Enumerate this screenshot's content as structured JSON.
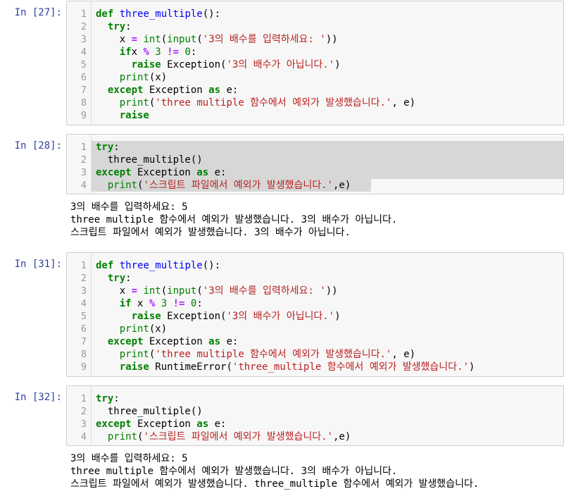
{
  "cells": [
    {
      "prompt": "In [27]:",
      "lines": [
        {
          "n": "1",
          "tokens": [
            [
              "kw",
              "def"
            ],
            [
              "",
              "  "
            ],
            [
              "fn",
              "three_multiple"
            ],
            [
              "",
              "():"
            ]
          ]
        },
        {
          "n": "2",
          "tokens": [
            [
              "",
              "    "
            ],
            [
              "kw",
              "try"
            ],
            [
              "",
              ":"
            ]
          ]
        },
        {
          "n": "3",
          "tokens": [
            [
              "",
              "        x "
            ],
            [
              "op",
              "="
            ],
            [
              "",
              ""
            ],
            [
              "bi",
              " int"
            ],
            [
              "",
              "("
            ],
            [
              "bi",
              "input"
            ],
            [
              "",
              "("
            ],
            [
              "str",
              "'3의 배수를 입력하세요: '"
            ],
            [
              "",
              "))"
            ]
          ]
        },
        {
          "n": "4",
          "tokens": [
            [
              "",
              "        "
            ],
            [
              "kw",
              "if"
            ],
            [
              "",
              ""
            ],
            [
              "",
              ""
            ],
            [
              "",
              ""
            ],
            [
              "",
              ""
            ],
            [
              "",
              ""
            ],
            [
              "",
              ""
            ],
            [
              "",
              ""
            ],
            [
              "",
              "x "
            ],
            [
              "op",
              "%"
            ],
            [
              "",
              ""
            ],
            [
              "num",
              " 3 "
            ],
            [
              "op",
              "!="
            ],
            [
              "num",
              " 0"
            ],
            [
              "",
              ":"
            ]
          ]
        },
        {
          "n": "5",
          "tokens": [
            [
              "",
              "            "
            ],
            [
              "kw",
              "raise"
            ],
            [
              "",
              "  Exception("
            ],
            [
              "str",
              "'3의 배수가 아닙니다.'"
            ],
            [
              "",
              ")"
            ]
          ]
        },
        {
          "n": "6",
          "tokens": [
            [
              "",
              "        "
            ],
            [
              "bi",
              "print"
            ],
            [
              "",
              "(x)"
            ]
          ]
        },
        {
          "n": "7",
          "tokens": [
            [
              "",
              "    "
            ],
            [
              "kw",
              "except"
            ],
            [
              "",
              "  Exception "
            ],
            [
              "kw",
              "as"
            ],
            [
              "",
              "  e:"
            ]
          ]
        },
        {
          "n": "8",
          "tokens": [
            [
              "",
              "        "
            ],
            [
              "bi",
              "print"
            ],
            [
              "",
              "("
            ],
            [
              "str",
              "'three multiple 함수에서 예외가 발생했습니다.'"
            ],
            [
              "",
              ", e)"
            ]
          ]
        },
        {
          "n": "9",
          "tokens": [
            [
              "",
              "        "
            ],
            [
              "kw",
              "raise"
            ]
          ]
        }
      ],
      "output": []
    },
    {
      "prompt": "In [28]:",
      "lines": [
        {
          "n": "1",
          "tokens": [
            [
              "kw",
              "try"
            ],
            [
              "",
              ":"
            ]
          ]
        },
        {
          "n": "2",
          "tokens": [
            [
              "",
              "    three_multiple()"
            ]
          ]
        },
        {
          "n": "3",
          "tokens": [
            [
              "kw",
              "except"
            ],
            [
              "",
              "  Exception "
            ],
            [
              "kw",
              "as"
            ],
            [
              "",
              "  e:"
            ]
          ]
        },
        {
          "n": "4",
          "tokens": [
            [
              "",
              "    "
            ],
            [
              "bi",
              "print"
            ],
            [
              "",
              "("
            ],
            [
              "str",
              "'스크립트 파일에서 예외가 발생했습니다.'"
            ],
            [
              "",
              ",e)"
            ]
          ]
        }
      ],
      "output": [
        "3의 배수를 입력하세요: 5",
        "three multiple 함수에서 예외가 발생했습니다. 3의 배수가 아닙니다.",
        "스크립트 파일에서 예외가 발생했습니다. 3의 배수가 아닙니다."
      ]
    },
    {
      "prompt": "In [31]:",
      "lines": [
        {
          "n": "1",
          "tokens": [
            [
              "kw",
              "def"
            ],
            [
              "",
              "  "
            ],
            [
              "fn",
              "three_multiple"
            ],
            [
              "",
              "():"
            ]
          ]
        },
        {
          "n": "2",
          "tokens": [
            [
              "",
              "    "
            ],
            [
              "kw",
              "try"
            ],
            [
              "",
              ":"
            ]
          ]
        },
        {
          "n": "3",
          "tokens": [
            [
              "",
              "        x "
            ],
            [
              "op",
              "="
            ],
            [
              "bi",
              " int"
            ],
            [
              "",
              "("
            ],
            [
              "bi",
              "input"
            ],
            [
              "",
              "("
            ],
            [
              "str",
              "'3의 배수를 입력하세요: '"
            ],
            [
              "",
              "))"
            ]
          ]
        },
        {
          "n": "4",
          "tokens": [
            [
              "",
              "        "
            ],
            [
              "kw",
              "if"
            ],
            [
              "",
              "  x "
            ],
            [
              "op",
              "%"
            ],
            [
              "num",
              " 3 "
            ],
            [
              "op",
              "!="
            ],
            [
              "num",
              " 0"
            ],
            [
              "",
              ":"
            ]
          ]
        },
        {
          "n": "5",
          "tokens": [
            [
              "",
              "            "
            ],
            [
              "kw",
              "raise"
            ],
            [
              "",
              "  Exception("
            ],
            [
              "str",
              "'3의 배수가 아닙니다.'"
            ],
            [
              "",
              ")"
            ]
          ]
        },
        {
          "n": "6",
          "tokens": [
            [
              "",
              "        "
            ],
            [
              "bi",
              "print"
            ],
            [
              "",
              "(x)"
            ]
          ]
        },
        {
          "n": "7",
          "tokens": [
            [
              "",
              "    "
            ],
            [
              "kw",
              "except"
            ],
            [
              "",
              "  Exception "
            ],
            [
              "kw",
              "as"
            ],
            [
              "",
              "  e:"
            ]
          ]
        },
        {
          "n": "8",
          "tokens": [
            [
              "",
              "        "
            ],
            [
              "bi",
              "print"
            ],
            [
              "",
              "("
            ],
            [
              "str",
              "'three multiple 함수에서 예외가 발생했습니다.'"
            ],
            [
              "",
              ", e)"
            ]
          ]
        },
        {
          "n": "9",
          "tokens": [
            [
              "",
              "        "
            ],
            [
              "kw",
              "raise"
            ],
            [
              "",
              "  RuntimeError("
            ],
            [
              "str",
              "'three_multiple 함수에서 예외가 발생했습니다.'"
            ],
            [
              "",
              ")"
            ]
          ]
        }
      ],
      "output": []
    },
    {
      "prompt": "In [32]:",
      "lines": [
        {
          "n": "1",
          "tokens": [
            [
              "kw",
              "try"
            ],
            [
              "",
              ":"
            ]
          ]
        },
        {
          "n": "2",
          "tokens": [
            [
              "",
              "    three_multiple()"
            ]
          ]
        },
        {
          "n": "3",
          "tokens": [
            [
              "kw",
              "except"
            ],
            [
              "",
              "  Exception "
            ],
            [
              "kw",
              "as"
            ],
            [
              "",
              "  e:"
            ]
          ]
        },
        {
          "n": "4",
          "tokens": [
            [
              "",
              "    "
            ],
            [
              "bi",
              "print"
            ],
            [
              "",
              "("
            ],
            [
              "str",
              "'스크립트 파일에서 예외가 발생했습니다.'"
            ],
            [
              "",
              ",e)"
            ]
          ]
        }
      ],
      "output": [
        "3의 배수를 입력하세요: 5",
        "three multiple 함수에서 예외가 발생했습니다. 3의 배수가 아닙니다.",
        "스크립트 파일에서 예외가 발생했습니다. three_multiple 함수에서 예외가 발생했습니다."
      ]
    }
  ],
  "colors": {
    "keyword": "#008000",
    "string": "#ba2121",
    "function": "#0000ff",
    "operator": "#aa22ff",
    "prompt": "#303f9f",
    "cell_background": "#f7f7f7",
    "selection": "#d7d7d7"
  }
}
